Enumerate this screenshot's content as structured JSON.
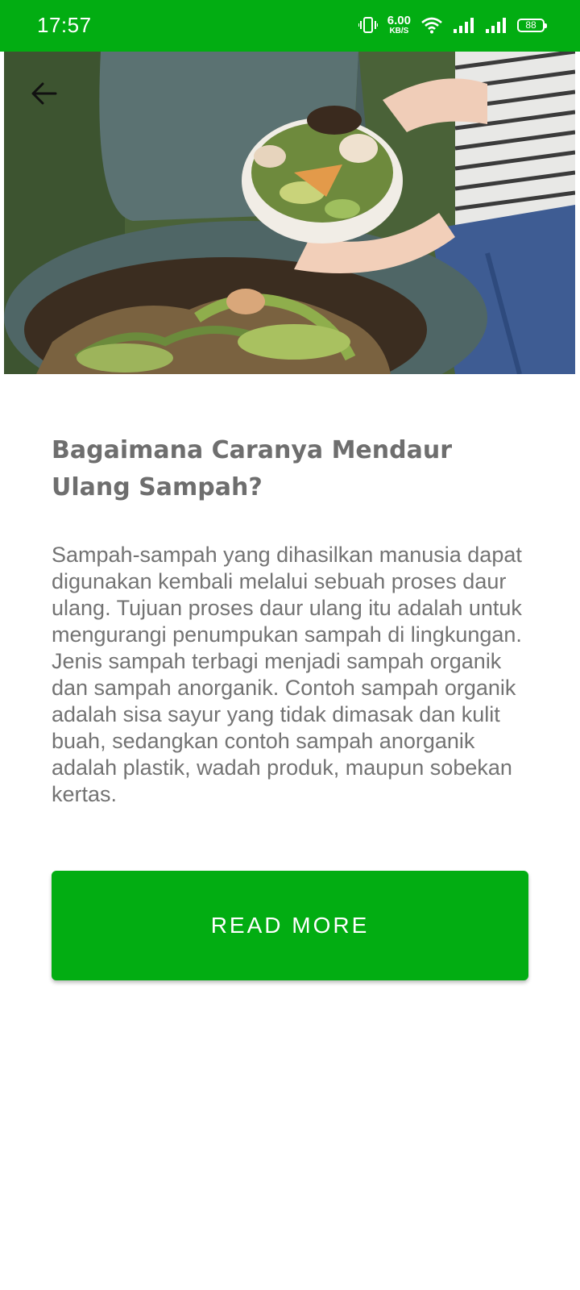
{
  "status_bar": {
    "time": "17:57",
    "net_speed_value": "6.00",
    "net_speed_unit": "KB/S",
    "battery": "88",
    "icons": [
      "vibrate-icon",
      "wifi-icon",
      "signal-icon",
      "signal-icon",
      "battery-icon"
    ]
  },
  "hero": {
    "image": "compost-bin-photo",
    "back_icon": "arrow-left-icon"
  },
  "article": {
    "title": "Bagaimana Caranya Mendaur Ulang Sampah?",
    "body": "Sampah-sampah yang dihasilkan manusia dapat digunakan kembali melalui sebuah proses daur ulang. Tujuan proses daur ulang itu adalah untuk mengurangi penumpukan sampah di lingkungan. Jenis sampah terbagi menjadi sampah organik dan sampah anorganik. Contoh sampah organik adalah sisa sayur yang tidak dimasak dan kulit buah, sedangkan contoh sampah anorganik adalah plastik, wadah produk, maupun sobekan kertas."
  },
  "read_more_label": "READ MORE",
  "colors": {
    "accent": "#02ad12",
    "title_text": "#6e6e6e",
    "body_text": "#737373"
  }
}
